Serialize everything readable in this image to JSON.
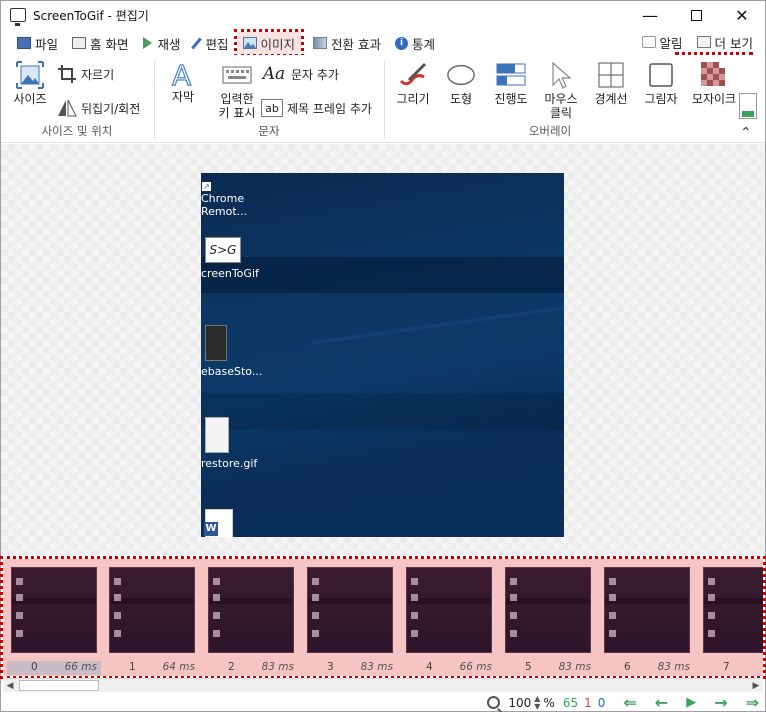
{
  "window": {
    "title": "ScreenToGif - 편집기"
  },
  "tabs": [
    {
      "label": "파일"
    },
    {
      "label": "홈 화면"
    },
    {
      "label": "재생"
    },
    {
      "label": "편집"
    },
    {
      "label": "이미지"
    },
    {
      "label": "전환 효과"
    },
    {
      "label": "통계"
    }
  ],
  "tab_right": {
    "notifications": "알림",
    "more": "더 보기"
  },
  "ribbon": {
    "size_group": {
      "label": "사이즈 및 위치",
      "size": "사이즈",
      "crop": "자르기",
      "flip_rotate": "뒤집기/회전"
    },
    "text_group": {
      "label": "문자",
      "caption": "자막",
      "key_strokes_1": "입력한",
      "key_strokes_2": "키 표시",
      "free_text": "문자 추가",
      "title_frame": "제목 프레임 추가"
    },
    "overlay_group": {
      "label": "오버레이",
      "draw": "그리기",
      "shape": "도형",
      "progress": "진행도",
      "mouse_click_1": "마우스",
      "mouse_click_2": "클릭",
      "border": "경계선",
      "shadow": "그림자",
      "mosaic": "모자이크"
    }
  },
  "desktop_icons": [
    {
      "label_1": "Chrome",
      "label_2": "Remot..."
    },
    {
      "label_1": "creenToGif",
      "label_2": ""
    },
    {
      "label_1": "ebaseSto...",
      "label_2": ""
    },
    {
      "label_1": "restore.gif",
      "label_2": ""
    }
  ],
  "frames": [
    {
      "index": "0",
      "delay": "66 ms"
    },
    {
      "index": "1",
      "delay": "64 ms"
    },
    {
      "index": "2",
      "delay": "83 ms"
    },
    {
      "index": "3",
      "delay": "83 ms"
    },
    {
      "index": "4",
      "delay": "66 ms"
    },
    {
      "index": "5",
      "delay": "83 ms"
    },
    {
      "index": "6",
      "delay": "83 ms"
    },
    {
      "index": "7",
      "delay": ""
    }
  ],
  "status": {
    "zoom": "100",
    "zoom_unit": "%",
    "frame_count": "65",
    "selected_count": "1",
    "current_frame": "0"
  }
}
